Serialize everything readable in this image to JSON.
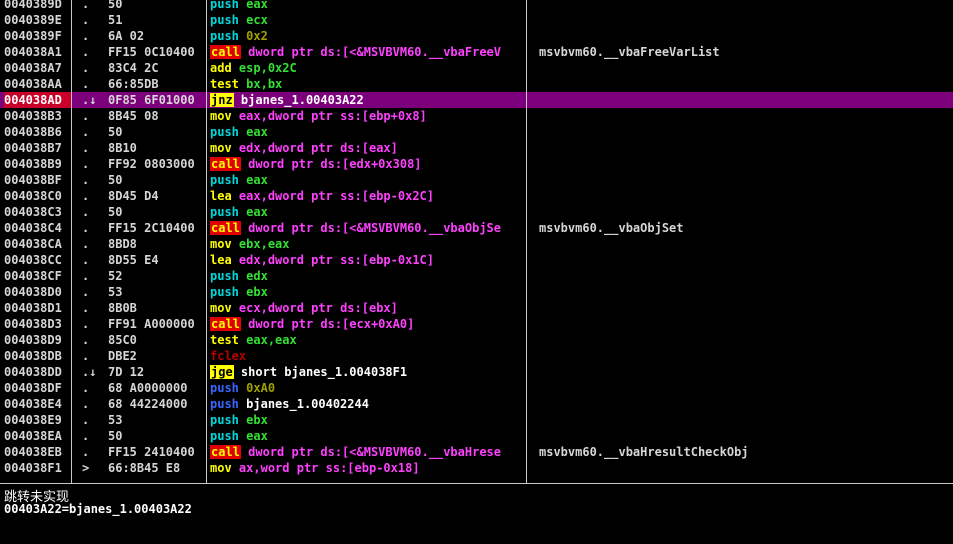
{
  "disasm": {
    "rows": [
      {
        "addr": "0040389D",
        "mark": ".",
        "hex": "50",
        "mn": "push",
        "op": "eax",
        "cmt": "",
        "t": "cyan",
        "o": "reg"
      },
      {
        "addr": "0040389E",
        "mark": ".",
        "hex": "51",
        "mn": "push",
        "op": "ecx",
        "cmt": "",
        "t": "cyan",
        "o": "reg"
      },
      {
        "addr": "0040389F",
        "mark": ".",
        "hex": "6A 02",
        "mn": "push",
        "op": "0x2",
        "cmt": "",
        "t": "cyan",
        "o": "num"
      },
      {
        "addr": "004038A1",
        "mark": ".",
        "hex": "FF15 0C10400",
        "mn": "call",
        "op": "dword ptr ds:[<&MSVBVM60.__vbaFreeV",
        "cmt": "msvbvm60.__vbaFreeVarList",
        "t": "call",
        "o": "mem"
      },
      {
        "addr": "004038A7",
        "mark": ".",
        "hex": "83C4 2C",
        "mn": "add",
        "op": "esp,0x2C",
        "cmt": "",
        "t": "yellow",
        "o": "reg"
      },
      {
        "addr": "004038AA",
        "mark": ".",
        "hex": "66:85DB",
        "mn": "test",
        "op": "bx,bx",
        "cmt": "",
        "t": "yellow",
        "o": "reg"
      },
      {
        "addr": "004038AD",
        "mark": ".↓",
        "hex": "0F85 6F01000",
        "mn": "jnz",
        "op": "bjanes_1.00403A22",
        "cmt": "",
        "t": "jcc",
        "o": "white",
        "sel": true
      },
      {
        "addr": "004038B3",
        "mark": ".",
        "hex": "8B45 08",
        "mn": "mov",
        "op": "eax,dword ptr ss:[ebp+0x8]",
        "cmt": "",
        "t": "yellow",
        "o": "mem"
      },
      {
        "addr": "004038B6",
        "mark": ".",
        "hex": "50",
        "mn": "push",
        "op": "eax",
        "cmt": "",
        "t": "cyan",
        "o": "reg"
      },
      {
        "addr": "004038B7",
        "mark": ".",
        "hex": "8B10",
        "mn": "mov",
        "op": "edx,dword ptr ds:[eax]",
        "cmt": "",
        "t": "yellow",
        "o": "mem"
      },
      {
        "addr": "004038B9",
        "mark": ".",
        "hex": "FF92 0803000",
        "mn": "call",
        "op": "dword ptr ds:[edx+0x308]",
        "cmt": "",
        "t": "call",
        "o": "mem"
      },
      {
        "addr": "004038BF",
        "mark": ".",
        "hex": "50",
        "mn": "push",
        "op": "eax",
        "cmt": "",
        "t": "cyan",
        "o": "reg"
      },
      {
        "addr": "004038C0",
        "mark": ".",
        "hex": "8D45 D4",
        "mn": "lea",
        "op": "eax,dword ptr ss:[ebp-0x2C]",
        "cmt": "",
        "t": "yellow",
        "o": "mem"
      },
      {
        "addr": "004038C3",
        "mark": ".",
        "hex": "50",
        "mn": "push",
        "op": "eax",
        "cmt": "",
        "t": "cyan",
        "o": "reg"
      },
      {
        "addr": "004038C4",
        "mark": ".",
        "hex": "FF15 2C10400",
        "mn": "call",
        "op": "dword ptr ds:[<&MSVBVM60.__vbaObjSe",
        "cmt": "msvbvm60.__vbaObjSet",
        "t": "call",
        "o": "mem"
      },
      {
        "addr": "004038CA",
        "mark": ".",
        "hex": "8BD8",
        "mn": "mov",
        "op": "ebx,eax",
        "cmt": "",
        "t": "yellow",
        "o": "reg"
      },
      {
        "addr": "004038CC",
        "mark": ".",
        "hex": "8D55 E4",
        "mn": "lea",
        "op": "edx,dword ptr ss:[ebp-0x1C]",
        "cmt": "",
        "t": "yellow",
        "o": "mem"
      },
      {
        "addr": "004038CF",
        "mark": ".",
        "hex": "52",
        "mn": "push",
        "op": "edx",
        "cmt": "",
        "t": "cyan",
        "o": "reg"
      },
      {
        "addr": "004038D0",
        "mark": ".",
        "hex": "53",
        "mn": "push",
        "op": "ebx",
        "cmt": "",
        "t": "cyan",
        "o": "reg"
      },
      {
        "addr": "004038D1",
        "mark": ".",
        "hex": "8B0B",
        "mn": "mov",
        "op": "ecx,dword ptr ds:[ebx]",
        "cmt": "",
        "t": "yellow",
        "o": "mem"
      },
      {
        "addr": "004038D3",
        "mark": ".",
        "hex": "FF91 A000000",
        "mn": "call",
        "op": "dword ptr ds:[ecx+0xA0]",
        "cmt": "",
        "t": "call",
        "o": "mem"
      },
      {
        "addr": "004038D9",
        "mark": ".",
        "hex": "85C0",
        "mn": "test",
        "op": "eax,eax",
        "cmt": "",
        "t": "yellow",
        "o": "reg"
      },
      {
        "addr": "004038DB",
        "mark": ".",
        "hex": "DBE2",
        "mn": "fclex",
        "op": "",
        "cmt": "",
        "t": "fpu",
        "o": "reg"
      },
      {
        "addr": "004038DD",
        "mark": ".↓",
        "hex": "7D 12",
        "mn": "jge",
        "op": "short bjanes_1.004038F1",
        "cmt": "",
        "t": "jcc",
        "o": "white"
      },
      {
        "addr": "004038DF",
        "mark": ".",
        "hex": "68 A0000000",
        "mn": "push",
        "op": "0xA0",
        "cmt": "",
        "t": "blue",
        "o": "num"
      },
      {
        "addr": "004038E4",
        "mark": ".",
        "hex": "68 44224000",
        "mn": "push",
        "op": "bjanes_1.00402244",
        "cmt": "",
        "t": "blue",
        "o": "white"
      },
      {
        "addr": "004038E9",
        "mark": ".",
        "hex": "53",
        "mn": "push",
        "op": "ebx",
        "cmt": "",
        "t": "cyan",
        "o": "reg"
      },
      {
        "addr": "004038EA",
        "mark": ".",
        "hex": "50",
        "mn": "push",
        "op": "eax",
        "cmt": "",
        "t": "cyan",
        "o": "reg"
      },
      {
        "addr": "004038EB",
        "mark": ".",
        "hex": "FF15 2410400",
        "mn": "call",
        "op": "dword ptr ds:[<&MSVBVM60.__vbaHrese",
        "cmt": "msvbvm60.__vbaHresultCheckObj",
        "t": "call",
        "o": "mem"
      },
      {
        "addr": "004038F1",
        "mark": ">",
        "hex": "66:8B45 E8",
        "mn": "mov",
        "op": "ax,word ptr ss:[ebp-0x18]",
        "cmt": "",
        "t": "yellow",
        "o": "mem"
      }
    ]
  },
  "status": {
    "line1": "跳转未实现",
    "line2": "00403A22=bjanes_1.00403A22"
  }
}
